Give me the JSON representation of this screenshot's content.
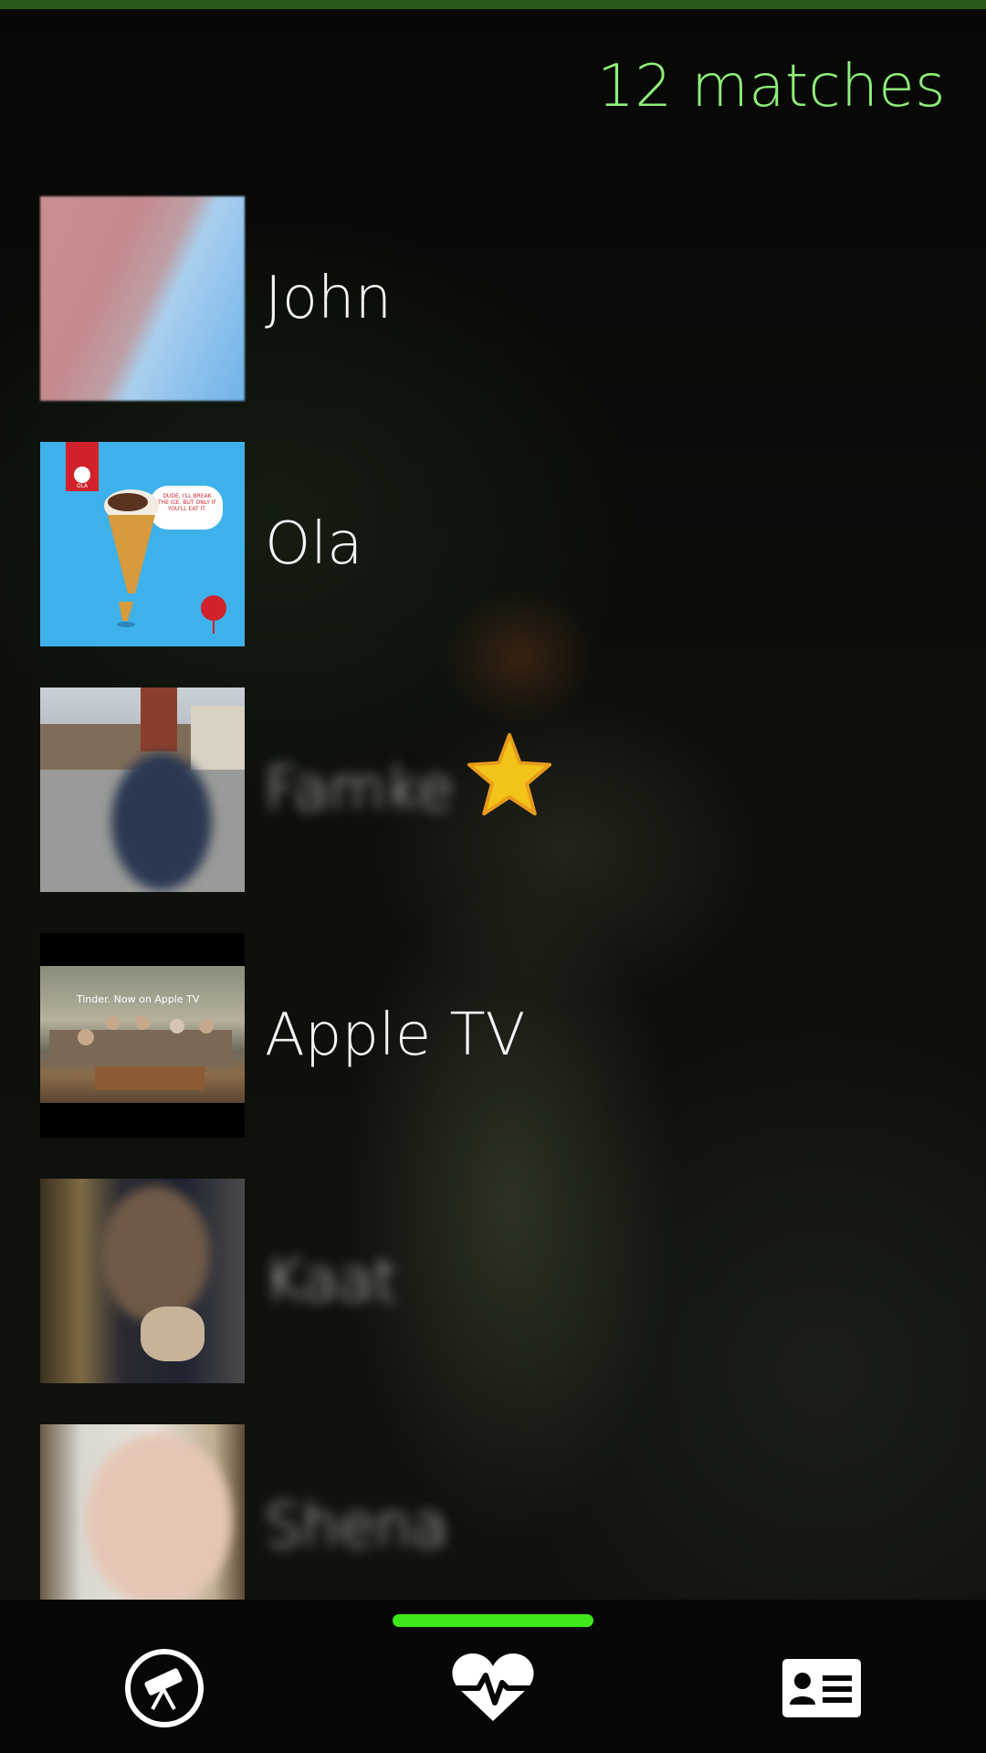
{
  "header": {
    "match_count_text": "12 matches",
    "accent_color": "#8ef07a"
  },
  "matches": [
    {
      "name": "John",
      "blurred": false,
      "starred": false
    },
    {
      "name": "Ola",
      "blurred": false,
      "starred": false
    },
    {
      "name": "Famke",
      "blurred": true,
      "starred": true
    },
    {
      "name": "Apple TV",
      "blurred": false,
      "starred": false
    },
    {
      "name": "Kaat",
      "blurred": true,
      "starred": false
    },
    {
      "name": "Shena",
      "blurred": true,
      "starred": false
    }
  ],
  "ads": {
    "ola_bubble_text": "DUDE, I'LL BREAK THE ICE. BUT ONLY IF YOU'LL EAT IT.",
    "ola_logo_text": "OLA",
    "apple_tv_caption": "Tinder. Now on Apple TV"
  },
  "nav": {
    "items": [
      {
        "icon": "telescope-icon",
        "label": "Discover"
      },
      {
        "icon": "heart-pulse-icon",
        "label": "Matches",
        "active": true
      },
      {
        "icon": "profile-card-icon",
        "label": "Profile"
      }
    ],
    "active_color": "#3ee81a"
  }
}
